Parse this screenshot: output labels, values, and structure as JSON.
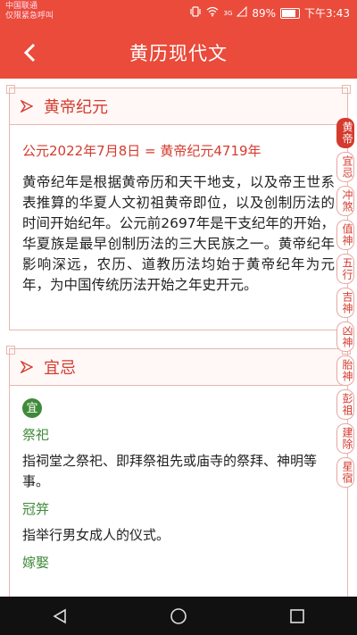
{
  "statusbar": {
    "carrier_line1": "中国联通",
    "carrier_line2": "仅限紧急呼叫",
    "battery": "89%",
    "time": "下午3:43",
    "signal_label": "3G"
  },
  "appbar": {
    "title": "黄历现代文",
    "back_icon": "chevron-left-icon"
  },
  "sections": [
    {
      "title": "黄帝纪元",
      "formula": "公元2022年7月8日 = 黄帝纪元4719年",
      "description": "黄帝纪年是根据黄帝历和天干地支，以及帝王世系表推算的华夏人文初祖黄帝即位，以及创制历法的时间开始纪年。公元前2697年是干支纪年的开始，华夏族是最早创制历法的三大民族之一。黄帝纪年影响深远，农历、道教历法均始于黄帝纪年为元年，为中国传统历法开始之年史开元。"
    },
    {
      "title": "宜忌",
      "badge": "宜",
      "terms": [
        {
          "name": "祭祀",
          "desc": "指祠堂之祭祀、即拜祭祖先或庙寺的祭拜、神明等事。"
        },
        {
          "name": "冠笄",
          "desc": "指举行男女成人的仪式。"
        },
        {
          "name": "嫁娶",
          "desc": ""
        }
      ]
    }
  ],
  "side_index": [
    "黄帝",
    "宜忌",
    "冲煞",
    "值神",
    "五行",
    "吉神",
    "凶神",
    "胎神",
    "彭祖",
    "建除",
    "星宿"
  ],
  "colors": {
    "brand": "#ea4b3b",
    "accent": "#d43b2e",
    "green": "#3f8a38"
  }
}
